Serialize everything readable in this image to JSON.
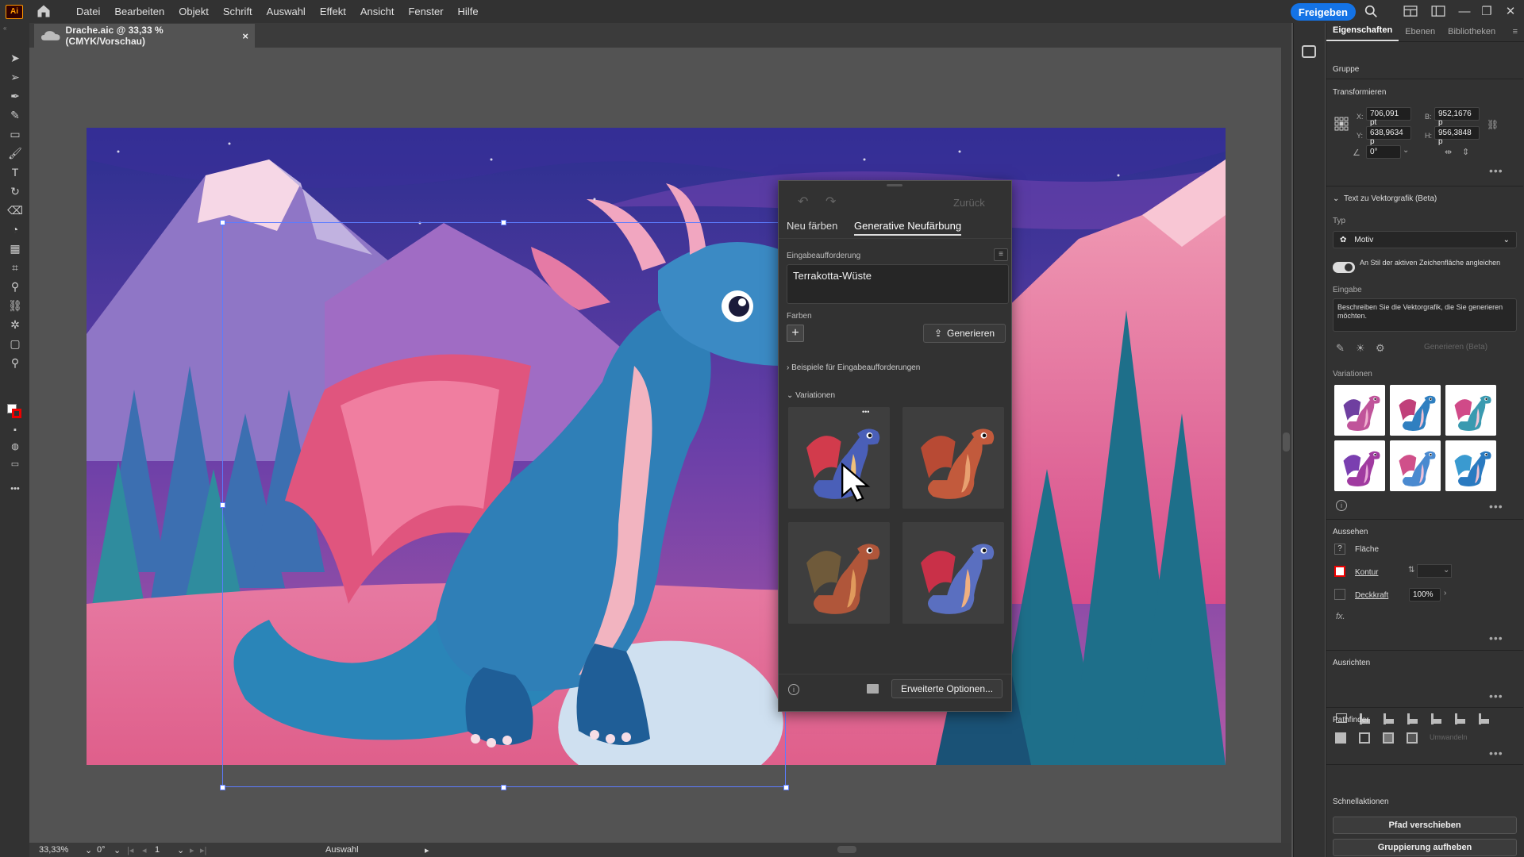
{
  "menubar": {
    "logo": "Ai",
    "menus": [
      "Datei",
      "Bearbeiten",
      "Objekt",
      "Schrift",
      "Auswahl",
      "Effekt",
      "Ansicht",
      "Fenster",
      "Hilfe"
    ],
    "share_label": "Freigeben",
    "accent_color": "#1473e6"
  },
  "document": {
    "tab_title": "Drache.aic @ 33,33 % (CMYK/Vorschau)",
    "close_glyph": "×"
  },
  "recolor": {
    "back_label": "Zurück",
    "tabs": [
      "Neu färben",
      "Generative Neufärbung"
    ],
    "active_tab": "Generative Neufärbung",
    "prompt_heading": "Eingabeaufforderung",
    "prompt_value": "Terrakotta-Wüste",
    "colors_heading": "Farben",
    "generate_label": "Generieren",
    "examples_label": "Beispiele für Eingabeaufforderungen",
    "variations_label": "Variationen",
    "advanced_label": "Erweiterte Optionen...",
    "more_glyph": "•••"
  },
  "properties": {
    "tabs": [
      "Eigenschaften",
      "Ebenen",
      "Bibliotheken"
    ],
    "active_tab": "Eigenschaften",
    "object_type": "Gruppe",
    "transform": {
      "heading": "Transformieren",
      "x_label": "X:",
      "x": "706,091 pt",
      "y_label": "Y:",
      "y": "638,9634 p",
      "w_label": "B:",
      "w": "952,1676 p",
      "h_label": "H:",
      "h": "956,3848 p",
      "angle": "0°"
    },
    "text_to_vector": {
      "heading": "Text zu Vektorgrafik (Beta)",
      "type_label": "Typ",
      "type_value": "Motiv",
      "match_style": "An Stil der aktiven Zeichenfläche angleichen",
      "input_label": "Eingabe",
      "input_placeholder": "Beschreiben Sie die Vektorgrafik, die Sie generieren möchten.",
      "generate_label": "Generieren (Beta)",
      "variations_label": "Variationen"
    },
    "appearance": {
      "heading": "Aussehen",
      "fill": "Fläche",
      "stroke": "Kontur",
      "opacity": "Deckkraft",
      "opacity_value": "100%",
      "fx": "fx."
    },
    "align_heading": "Ausrichten",
    "pathfinder_heading": "Pathfinder",
    "pathfinder_expand": "Umwandeln",
    "quick_actions_heading": "Schnellaktionen",
    "quick_actions": [
      "Pfad verschieben",
      "Gruppierung aufheben"
    ]
  },
  "statusbar": {
    "zoom": "33,33%",
    "rotation": "0°",
    "artboard": "1",
    "tool": "Auswahl"
  }
}
